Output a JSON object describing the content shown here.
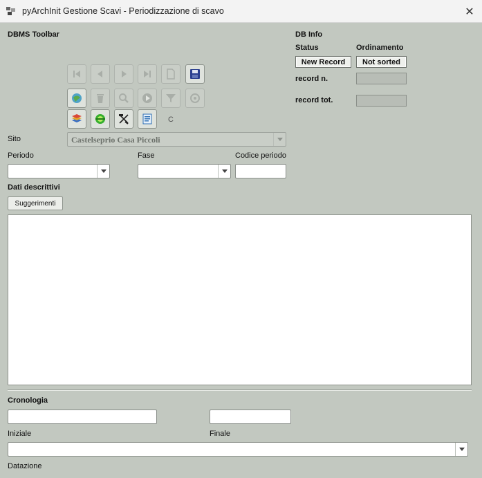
{
  "window": {
    "title": "pyArchInit Gestione Scavi - Periodizzazione di scavo",
    "close_glyph": "✕"
  },
  "toolbar": {
    "section_label": "DBMS Toolbar",
    "c_label": "C"
  },
  "db_info": {
    "title": "DB Info",
    "status_label": "Status",
    "ordinamento_label": "Ordinamento",
    "status_value": "New Record",
    "ordinamento_value": "Not sorted",
    "record_n_label": "record n.",
    "record_tot_label": "record tot."
  },
  "form": {
    "sito_label": "Sito",
    "sito_value": "Castelseprio Casa Piccoli",
    "periodo_label": "Periodo",
    "fase_label": "Fase",
    "codice_periodo_label": "Codice periodo",
    "dati_descrittivi_label": "Dati descrittivi",
    "suggerimenti_label": "Suggerimenti",
    "cronologia_label": "Cronologia",
    "iniziale_label": "Iniziale",
    "finale_label": "Finale",
    "datazione_label": "Datazione"
  },
  "colors": {
    "background": "#c2c8c0",
    "titlebar": "#f3f3f3"
  },
  "icons": [
    "first-record-icon",
    "prev-record-icon",
    "next-record-icon",
    "last-record-icon",
    "new-record-icon",
    "save-icon",
    "globe-icon",
    "trash-icon",
    "search-icon",
    "play-icon",
    "filter-icon",
    "reset-icon",
    "layers-icon",
    "gis-globe-icon",
    "tool-icon",
    "report-icon"
  ]
}
